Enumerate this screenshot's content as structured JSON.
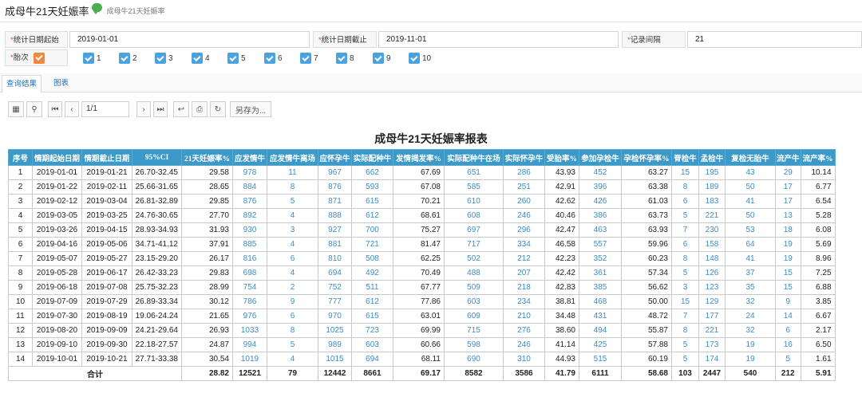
{
  "header": {
    "title": "成母牛21天妊娠率",
    "subtitle": "成母牛21天妊娠率"
  },
  "filters": {
    "start_label": "统计日期起始",
    "start_value": "2019-01-01",
    "end_label": "统计日期截止",
    "end_value": "2019-11-01",
    "interval_label": "记录间隔",
    "interval_value": "21",
    "parity_label": "胎次",
    "parities": [
      "1",
      "2",
      "3",
      "4",
      "5",
      "6",
      "7",
      "8",
      "9",
      "10"
    ]
  },
  "tabs": {
    "results": "查询结果",
    "chart": "图表"
  },
  "toolbar": {
    "page": "1/1",
    "save_as": "另存为..."
  },
  "report": {
    "title": "成母牛21天妊娠率报表",
    "columns": [
      "序号",
      "情期起始日期",
      "情期截止日期",
      "95%CI",
      "21天妊娠率%",
      "应发情牛",
      "应发情牛离场",
      "应怀孕牛",
      "实际配种牛",
      "发情揭发率%",
      "实际配种牛在场",
      "实际怀孕牛",
      "受胎率%",
      "参加孕检牛",
      "孕检怀孕率%",
      "脊检牛",
      "孟检牛",
      "复检无胎牛",
      "流产牛",
      "流产率%"
    ],
    "rows": [
      [
        "1",
        "2019-01-01",
        "2019-01-21",
        "26.70-32.45",
        "29.58",
        "978",
        "11",
        "967",
        "662",
        "67.69",
        "651",
        "286",
        "43.93",
        "452",
        "63.27",
        "15",
        "195",
        "43",
        "29",
        "10.14"
      ],
      [
        "2",
        "2019-01-22",
        "2019-02-11",
        "25.66-31.65",
        "28.65",
        "884",
        "8",
        "876",
        "593",
        "67.08",
        "585",
        "251",
        "42.91",
        "396",
        "63.38",
        "8",
        "189",
        "50",
        "17",
        "6.77"
      ],
      [
        "3",
        "2019-02-12",
        "2019-03-04",
        "26.81-32.89",
        "29.85",
        "876",
        "5",
        "871",
        "615",
        "70.21",
        "610",
        "260",
        "42.62",
        "426",
        "61.03",
        "6",
        "183",
        "41",
        "17",
        "6.54"
      ],
      [
        "4",
        "2019-03-05",
        "2019-03-25",
        "24.76-30.65",
        "27.70",
        "892",
        "4",
        "888",
        "612",
        "68.61",
        "608",
        "246",
        "40.46",
        "386",
        "63.73",
        "5",
        "221",
        "50",
        "13",
        "5.28"
      ],
      [
        "5",
        "2019-03-26",
        "2019-04-15",
        "28.93-34.93",
        "31.93",
        "930",
        "3",
        "927",
        "700",
        "75.27",
        "697",
        "296",
        "42.47",
        "463",
        "63.93",
        "7",
        "230",
        "53",
        "18",
        "6.08"
      ],
      [
        "6",
        "2019-04-16",
        "2019-05-06",
        "34.71-41.12",
        "37.91",
        "885",
        "4",
        "881",
        "721",
        "81.47",
        "717",
        "334",
        "46.58",
        "557",
        "59.96",
        "6",
        "158",
        "64",
        "19",
        "5.69"
      ],
      [
        "7",
        "2019-05-07",
        "2019-05-27",
        "23.15-29.20",
        "26.17",
        "816",
        "6",
        "810",
        "508",
        "62.25",
        "502",
        "212",
        "42.23",
        "352",
        "60.23",
        "8",
        "148",
        "41",
        "19",
        "8.96"
      ],
      [
        "8",
        "2019-05-28",
        "2019-06-17",
        "26.42-33.23",
        "29.83",
        "698",
        "4",
        "694",
        "492",
        "70.49",
        "488",
        "207",
        "42.42",
        "361",
        "57.34",
        "5",
        "126",
        "37",
        "15",
        "7.25"
      ],
      [
        "9",
        "2019-06-18",
        "2019-07-08",
        "25.75-32.23",
        "28.99",
        "754",
        "2",
        "752",
        "511",
        "67.77",
        "509",
        "218",
        "42.83",
        "385",
        "56.62",
        "3",
        "123",
        "35",
        "15",
        "6.88"
      ],
      [
        "10",
        "2019-07-09",
        "2019-07-29",
        "26.89-33.34",
        "30.12",
        "786",
        "9",
        "777",
        "612",
        "77.86",
        "603",
        "234",
        "38.81",
        "468",
        "50.00",
        "15",
        "129",
        "32",
        "9",
        "3.85"
      ],
      [
        "11",
        "2019-07-30",
        "2019-08-19",
        "19.06-24.24",
        "21.65",
        "976",
        "6",
        "970",
        "615",
        "63.01",
        "609",
        "210",
        "34.48",
        "431",
        "48.72",
        "7",
        "177",
        "24",
        "14",
        "6.67"
      ],
      [
        "12",
        "2019-08-20",
        "2019-09-09",
        "24.21-29.64",
        "26.93",
        "1033",
        "8",
        "1025",
        "723",
        "69.99",
        "715",
        "276",
        "38.60",
        "494",
        "55.87",
        "8",
        "221",
        "32",
        "6",
        "2.17"
      ],
      [
        "13",
        "2019-09-10",
        "2019-09-30",
        "22.18-27.57",
        "24.87",
        "994",
        "5",
        "989",
        "603",
        "60.66",
        "598",
        "246",
        "41.14",
        "425",
        "57.88",
        "5",
        "173",
        "19",
        "16",
        "6.50"
      ],
      [
        "14",
        "2019-10-01",
        "2019-10-21",
        "27.71-33.38",
        "30.54",
        "1019",
        "4",
        "1015",
        "694",
        "68.11",
        "690",
        "310",
        "44.93",
        "515",
        "60.19",
        "5",
        "174",
        "19",
        "5",
        "1.61"
      ]
    ],
    "total_label": "合计",
    "totals": [
      "28.82",
      "12521",
      "79",
      "12442",
      "8661",
      "69.17",
      "8582",
      "3586",
      "41.79",
      "6111",
      "58.68",
      "103",
      "2447",
      "540",
      "212",
      "5.91"
    ]
  }
}
